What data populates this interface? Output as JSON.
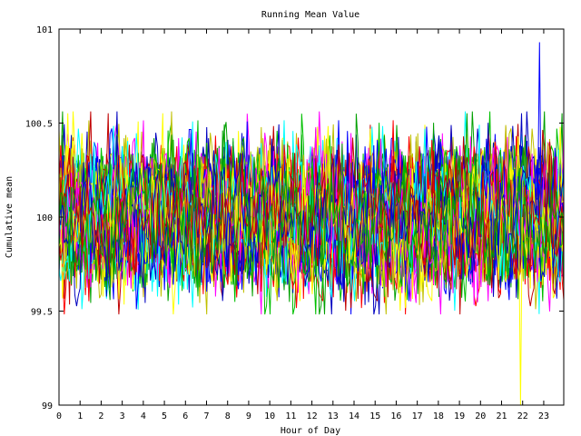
{
  "chart_data": {
    "type": "line",
    "title": "Running Mean Value",
    "xlabel": "Hour of Day",
    "ylabel": "Cumulative mean",
    "xlim": [
      0,
      23.95
    ],
    "ylim": [
      99,
      101
    ],
    "x_ticks": [
      0,
      1,
      2,
      3,
      4,
      5,
      6,
      7,
      8,
      9,
      10,
      11,
      12,
      13,
      14,
      15,
      16,
      17,
      18,
      19,
      20,
      21,
      22,
      23
    ],
    "y_ticks": [
      99,
      99.5,
      100,
      100.5,
      101
    ],
    "y_tick_labels": [
      "99",
      "99.5",
      "100",
      "100.5",
      "101"
    ],
    "grid": false,
    "legend": "none",
    "background": "#ffffff",
    "series_colors": [
      "#ff0000",
      "#00c000",
      "#0000ff",
      "#ff00ff",
      "#00ffff",
      "#c0c000",
      "#ffff00",
      "#0000c0",
      "#c00000",
      "#00a000"
    ],
    "series_count": 60,
    "points_per_series": 288,
    "central_value": 100,
    "typical_range": [
      99.55,
      100.45
    ],
    "observed_extremes": {
      "max": {
        "x": 22.8,
        "y": 100.93
      },
      "min": {
        "x": 21.9,
        "y": 99.0
      }
    }
  }
}
